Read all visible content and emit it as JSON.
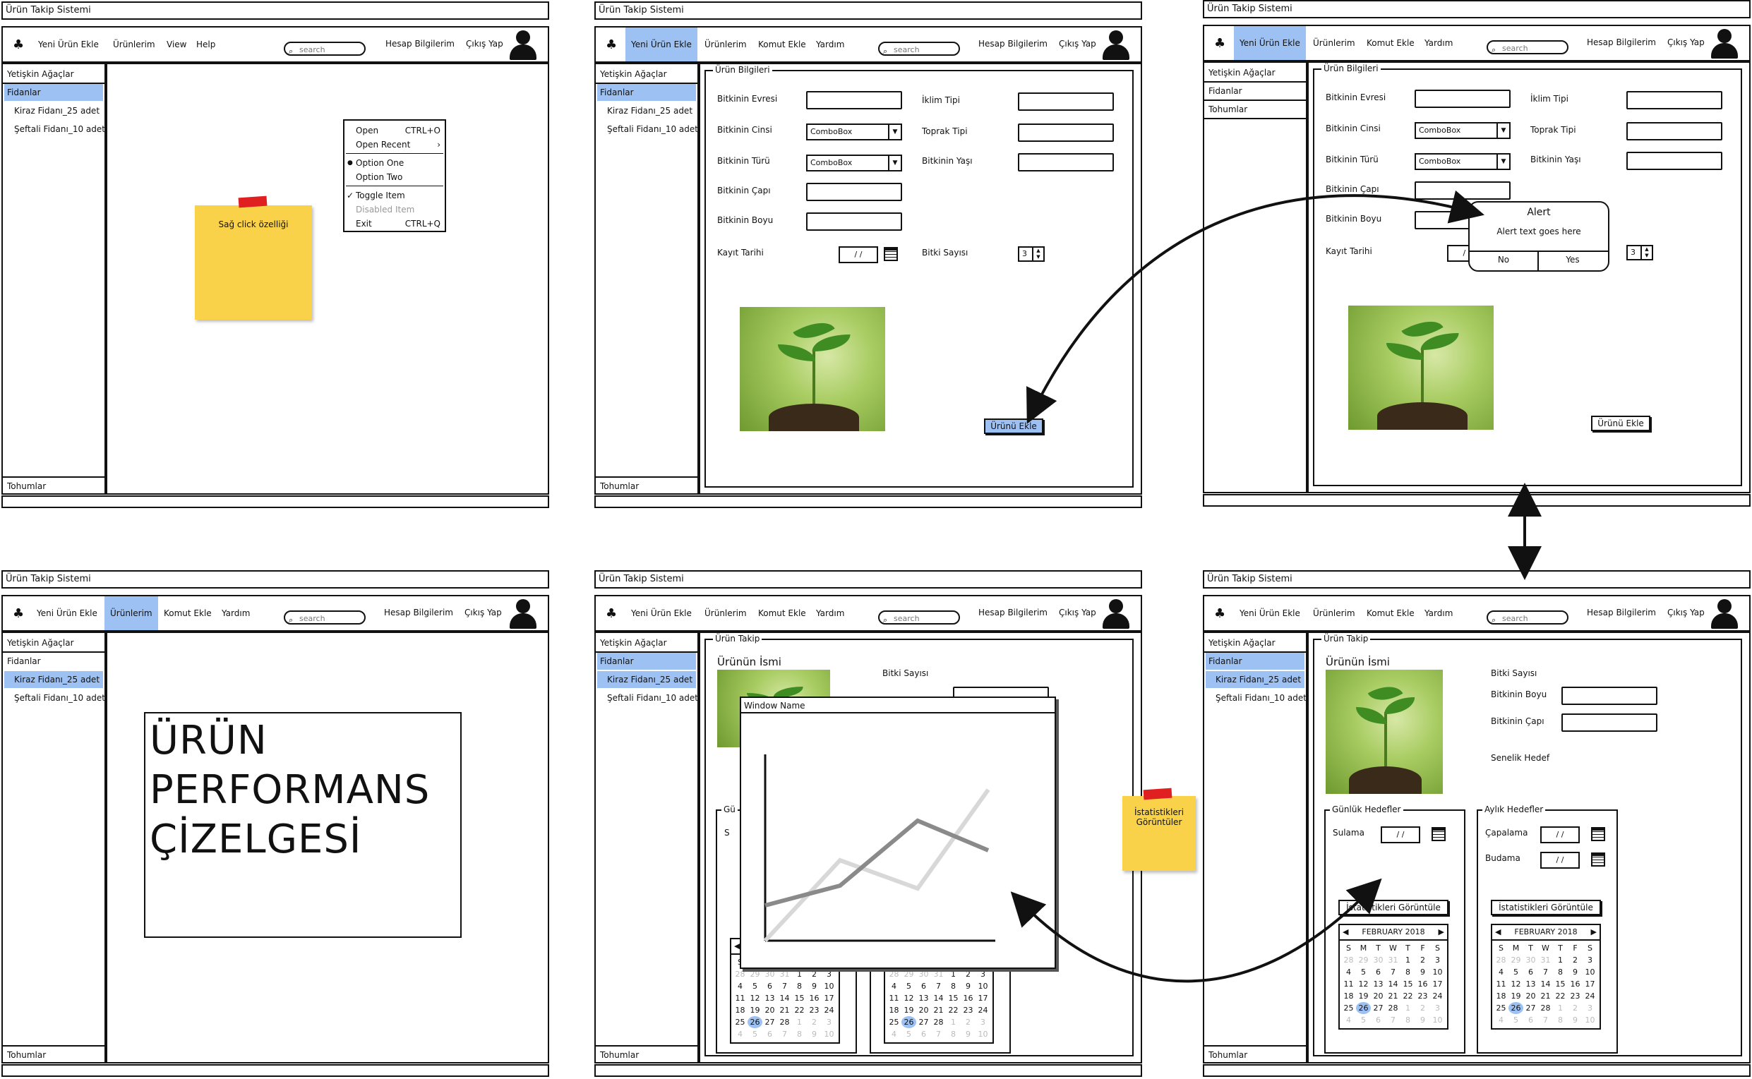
{
  "app_title": "Ürün Takip Sistemi",
  "nav": {
    "new_product": "Yeni Ürün Ekle",
    "products": "Ürünlerim",
    "view": "View",
    "help_en": "Help",
    "add_command": "Komut Ekle",
    "help": "Yardım",
    "search_placeholder": "search",
    "account": "Hesap Bilgilerim",
    "logout": "Çıkış Yap"
  },
  "sidebar": {
    "adult_trees": "Yetişkin Ağaçlar",
    "saplings": "Fidanlar",
    "cherry": "Kiraz Fidanı_25 adet",
    "peach": "Şeftali Fidanı_10 adet",
    "seeds": "Tohumlar"
  },
  "context_menu": {
    "open": "Open",
    "open_sc": "CTRL+O",
    "open_recent": "Open Recent",
    "open_recent_arrow": "›",
    "option_one": "Option One",
    "option_one_mark": "●",
    "option_two": "Option Two",
    "toggle_item": "Toggle Item",
    "toggle_mark": "✓",
    "disabled_item": "Disabled Item",
    "exit": "Exit",
    "exit_sc": "CTRL+Q"
  },
  "sticky1": "Sağ click özelliği",
  "sticky2": "İstatistikleri Görüntüler",
  "form": {
    "legend": "Ürün Bilgileri",
    "habitat": "Bitkinin Evresi",
    "genus": "Bitkinin Cinsi",
    "species": "Bitkinin Türü",
    "diameter": "Bitkinin Çapı",
    "height": "Bitkinin Boyu",
    "reg_date": "Kayıt Tarihi",
    "climate": "İklim Tipi",
    "soil": "Toprak Tipi",
    "age": "Bitkinin Yaşı",
    "plant_count": "Bitki Sayısı",
    "combobox": "ComboBox",
    "date_placeholder": "/ /",
    "count_value": "3",
    "add_button": "Ürünü Ekle"
  },
  "alert": {
    "title": "Alert",
    "text": "Alert text goes here",
    "no": "No",
    "yes": "Yes"
  },
  "performance_title": [
    "ÜRÜN",
    "PERFORMANS",
    "ÇİZELGESİ"
  ],
  "tracking": {
    "legend": "Ürün Takip",
    "product_name": "Ürünün İsmi",
    "plant_count": "Bitki Sayısı",
    "height": "Bitkinin Boyu",
    "diameter": "Bitkinin Çapı",
    "annual_goal": "Senelik Hedef",
    "daily_goals": "Günlük Hedefler",
    "monthly_goals": "Aylık Hedefler",
    "watering": "Sulama",
    "hoeing": "Çapalama",
    "pruning": "Budama",
    "view_stats": "İstatistikleri Görüntüle",
    "window_name": "Window Name",
    "truncated_daily": "Gü",
    "truncated_s": "S"
  },
  "calendar": {
    "month": "FEBRUARY 2018",
    "prev": "◀",
    "next": "▶",
    "weekdays": [
      "S",
      "M",
      "T",
      "W",
      "T",
      "F",
      "S"
    ],
    "weeks": [
      [
        "28",
        "29",
        "30",
        "31",
        "1",
        "2",
        "3"
      ],
      [
        "4",
        "5",
        "6",
        "7",
        "8",
        "9",
        "10"
      ],
      [
        "11",
        "12",
        "13",
        "14",
        "15",
        "16",
        "17"
      ],
      [
        "18",
        "19",
        "20",
        "21",
        "22",
        "23",
        "24"
      ],
      [
        "25",
        "26",
        "27",
        "28",
        "1",
        "2",
        "3"
      ],
      [
        "4",
        "5",
        "6",
        "7",
        "8",
        "9",
        "10"
      ]
    ],
    "selected": "26"
  },
  "colors": {
    "accent": "#9dc1f2",
    "sticky": "#f9d24a",
    "tape": "#e02020",
    "line_dark": "#8a8a8a",
    "line_light": "#d8d8d8"
  }
}
